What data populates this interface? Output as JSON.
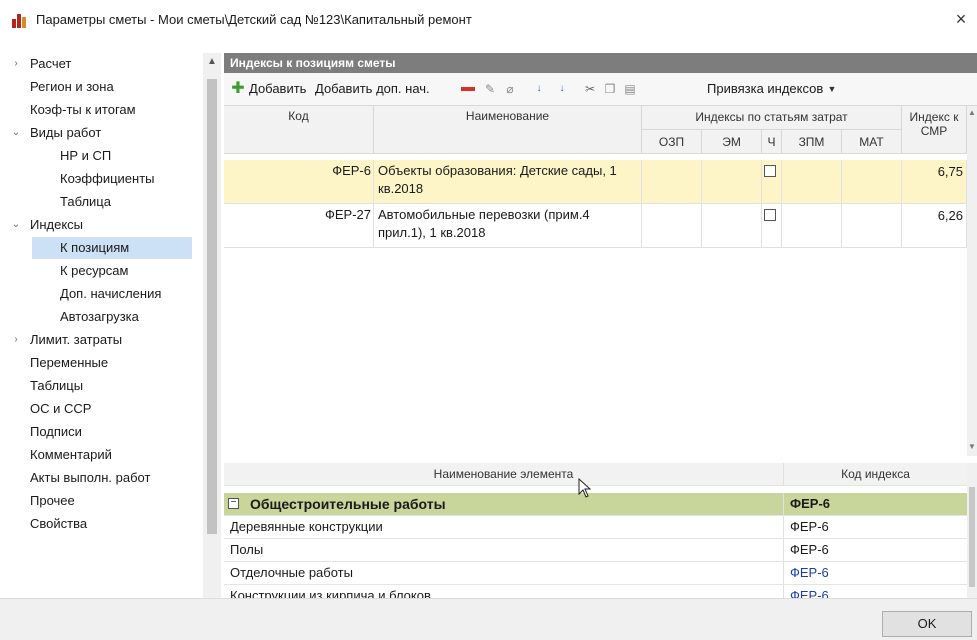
{
  "window": {
    "title": "Параметры сметы - Мои сметы\\Детский сад №123\\Капитальный ремонт",
    "close_glyph": "×"
  },
  "tree": {
    "items": [
      {
        "label": "Расчет",
        "arrow": "›"
      },
      {
        "label": "Регион и зона"
      },
      {
        "label": "Коэф-ты к итогам"
      },
      {
        "label": "Виды работ",
        "arrow": "⌄"
      },
      {
        "label": "НР и СП"
      },
      {
        "label": "Коэффициенты"
      },
      {
        "label": "Таблица"
      },
      {
        "label": "Индексы",
        "arrow": "⌄"
      },
      {
        "label": "К позициям",
        "selected": true
      },
      {
        "label": "К ресурсам"
      },
      {
        "label": "Доп. начисления"
      },
      {
        "label": "Автозагрузка"
      },
      {
        "label": "Лимит. затраты",
        "arrow": "›"
      },
      {
        "label": "Переменные"
      },
      {
        "label": "Таблицы"
      },
      {
        "label": "ОС и ССР"
      },
      {
        "label": "Подписи"
      },
      {
        "label": "Комментарий"
      },
      {
        "label": "Акты выполн. работ"
      },
      {
        "label": "Прочее"
      },
      {
        "label": "Свойства"
      }
    ]
  },
  "panel": {
    "header": "Индексы к позициям сметы"
  },
  "toolbar": {
    "add_label": "Добавить",
    "add_extra_label": "Добавить доп. нач.",
    "binding_label": "Привязка индексов"
  },
  "grid_top": {
    "headers": {
      "code": "Код",
      "name": "Наименование",
      "group": "Индексы по статьям затрат",
      "ozp": "ОЗП",
      "em": "ЭМ",
      "ch": "Ч",
      "zpm": "ЗПМ",
      "mat": "МАТ",
      "smr": "Индекс к СМР"
    },
    "rows": [
      {
        "code": "ФЕР-6",
        "name": "Объекты образования: Детские сады, 1 кв.2018",
        "smr": "6,75"
      },
      {
        "code": "ФЕР-27",
        "name": "Автомобильные перевозки (прим.4 прил.1), 1 кв.2018",
        "smr": "6,26"
      }
    ]
  },
  "grid_bottom": {
    "headers": {
      "name": "Наименование элемента",
      "code": "Код индекса"
    },
    "rows": [
      {
        "name": "Общестроительные работы",
        "code": "ФЕР-6"
      },
      {
        "name": "Деревянные конструкции",
        "code": "ФЕР-6"
      },
      {
        "name": "Полы",
        "code": "ФЕР-6"
      },
      {
        "name": "Отделочные работы",
        "code": "ФЕР-6"
      },
      {
        "name": "Конструкции из кирпича и блоков",
        "code": "ФЕР-6"
      }
    ]
  },
  "footer": {
    "ok_label": "OK"
  },
  "colors": {
    "selected_row": "#fdf5c7",
    "group_row": "#c8d69c",
    "tree_selection": "#cce1f5",
    "panel_header": "#7d7d7d",
    "link_code": "#1a3ea6"
  }
}
